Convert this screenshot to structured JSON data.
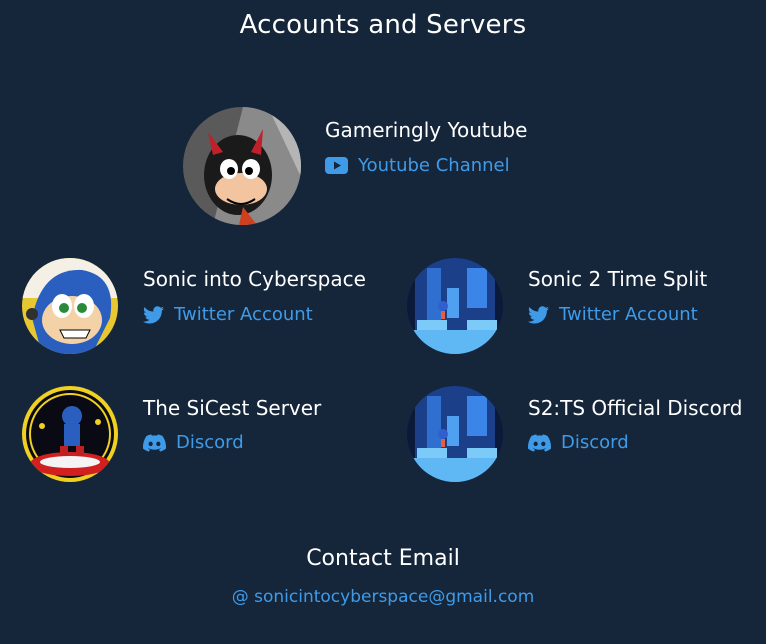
{
  "page": {
    "title": "Accounts and Servers"
  },
  "accounts": [
    {
      "name": "Gameringly Youtube",
      "link_label": "Youtube Channel",
      "link_icon": "youtube-icon"
    },
    {
      "name": "Sonic into Cyberspace",
      "link_label": "Twitter Account",
      "link_icon": "twitter-icon"
    },
    {
      "name": "Sonic 2 Time Split",
      "link_label": "Twitter Account",
      "link_icon": "twitter-icon"
    },
    {
      "name": "The SiCest Server",
      "link_label": "Discord",
      "link_icon": "discord-icon"
    },
    {
      "name": "S2:TS Official Discord",
      "link_label": "Discord",
      "link_icon": "discord-icon"
    }
  ],
  "contact": {
    "title": "Contact Email",
    "email": "@ sonicintocyberspace@gmail.com"
  },
  "colors": {
    "background": "#15263b",
    "link": "#3f9be8",
    "text": "#ffffff"
  }
}
